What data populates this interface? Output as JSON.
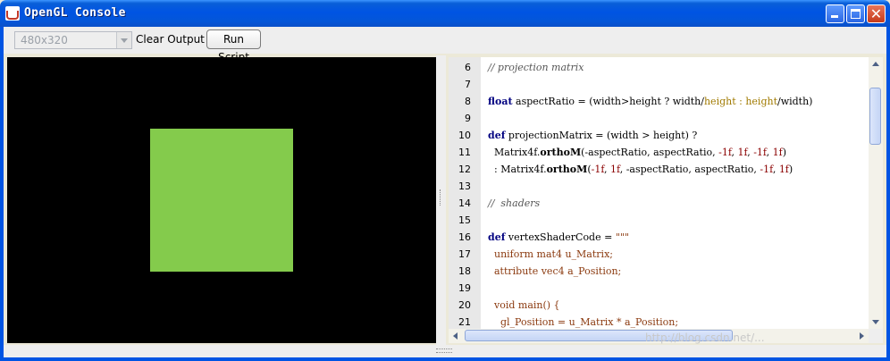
{
  "window": {
    "title": "OpenGL Console",
    "controls": {
      "minimize": "minimize-icon",
      "maximize": "maximize-icon",
      "close": "close-icon"
    }
  },
  "toolbar": {
    "resolution": {
      "selected": "480x320",
      "enabled": false
    },
    "clear_label": "Clear Output",
    "run_label": "Run Script"
  },
  "canvas": {
    "background": "#000000",
    "shape_color": "#84cb4c"
  },
  "editor": {
    "lines": [
      {
        "n": "6",
        "html": "<span class=\"cm\">// projection matrix</span>"
      },
      {
        "n": "7",
        "html": ""
      },
      {
        "n": "8",
        "html": "<span class=\"kw\">float</span> aspectRatio = (width&gt;height ? width/<span class=\"gold\">height : height</span>/width)"
      },
      {
        "n": "9",
        "html": ""
      },
      {
        "n": "10",
        "html": "<span class=\"kw\">def</span> projectionMatrix = (width &gt; height) ?"
      },
      {
        "n": "11",
        "html": "  Matrix4f.<span class=\"fn\">orthoM</span>(-aspectRatio, aspectRatio, <span class=\"num-lit\">-1f</span>, <span class=\"num-lit\">1f</span>, <span class=\"num-lit\">-1f</span>, <span class=\"num-lit\">1f</span>)"
      },
      {
        "n": "12",
        "html": "  : Matrix4f.<span class=\"fn\">orthoM</span>(<span class=\"num-lit\">-1f</span>, <span class=\"num-lit\">1f</span>, -aspectRatio, aspectRatio, <span class=\"num-lit\">-1f</span>, <span class=\"num-lit\">1f</span>)"
      },
      {
        "n": "13",
        "html": ""
      },
      {
        "n": "14",
        "html": "<span class=\"cm\">//  shaders</span>"
      },
      {
        "n": "15",
        "html": ""
      },
      {
        "n": "16",
        "html": "<span class=\"kw\">def</span> vertexShaderCode = <span class=\"str\">\"\"\"</span>"
      },
      {
        "n": "17",
        "html": "<span class=\"str\">  uniform mat4 u_Matrix;</span>"
      },
      {
        "n": "18",
        "html": "<span class=\"str\">  attribute vec4 a_Position;</span>"
      },
      {
        "n": "19",
        "html": ""
      },
      {
        "n": "20",
        "html": "<span class=\"str\">  void main() {</span>"
      },
      {
        "n": "21",
        "html": "<span class=\"str\">    gl_Position = u_Matrix * a_Position;</span>"
      }
    ]
  },
  "watermark": "http://blog.csdn.net/..."
}
